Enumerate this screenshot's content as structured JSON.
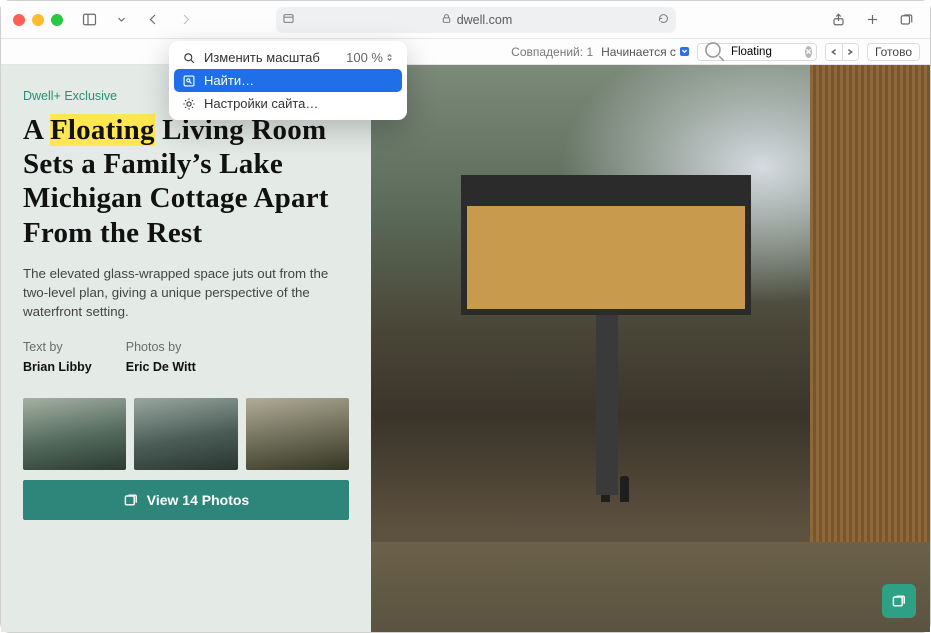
{
  "browser": {
    "url_host": "dwell.com"
  },
  "dropdown": {
    "zoom_label": "Изменить масштаб",
    "zoom_value": "100 %",
    "find_label": "Найти…",
    "settings_label": "Настройки сайта…"
  },
  "findbar": {
    "matches_label": "Совпадений:",
    "matches_count": "1",
    "mode_label": "Начинается с",
    "search_value": "Floating",
    "done_label": "Готово"
  },
  "article": {
    "tag": "Dwell+ Exclusive",
    "headline_pre": "A ",
    "headline_highlight": "Floating",
    "headline_post": " Living Room Sets a Family’s Lake Michigan Cottage Apart From the Rest",
    "lede": "The elevated glass-wrapped space juts out from the two-level plan, giving a unique perspective of the waterfront setting.",
    "text_by_label": "Text by",
    "text_by": "Brian Libby",
    "photos_by_label": "Photos by",
    "photos_by": "Eric De Witt",
    "view_photos_label": "View 14 Photos"
  }
}
